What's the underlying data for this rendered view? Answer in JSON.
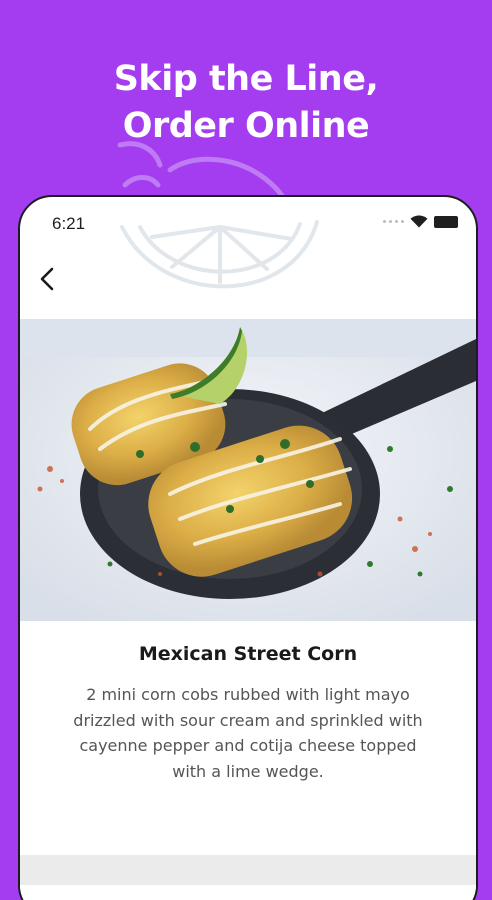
{
  "promo": {
    "headline_line1": "Skip the Line,",
    "headline_line2": "Order Online",
    "background_color": "#a43cf0"
  },
  "status_bar": {
    "time": "6:21",
    "icons": [
      "signal-dots-icon",
      "wifi-icon",
      "battery-icon"
    ]
  },
  "nav": {
    "back_icon": "chevron-left-icon"
  },
  "item": {
    "image": "mexican-street-corn-photo",
    "name": "Mexican Street Corn",
    "description": "2 mini corn cobs rubbed with light mayo drizzled with sour cream and sprinkled with cayenne pepper and cotija cheese topped with a lime wedge."
  }
}
